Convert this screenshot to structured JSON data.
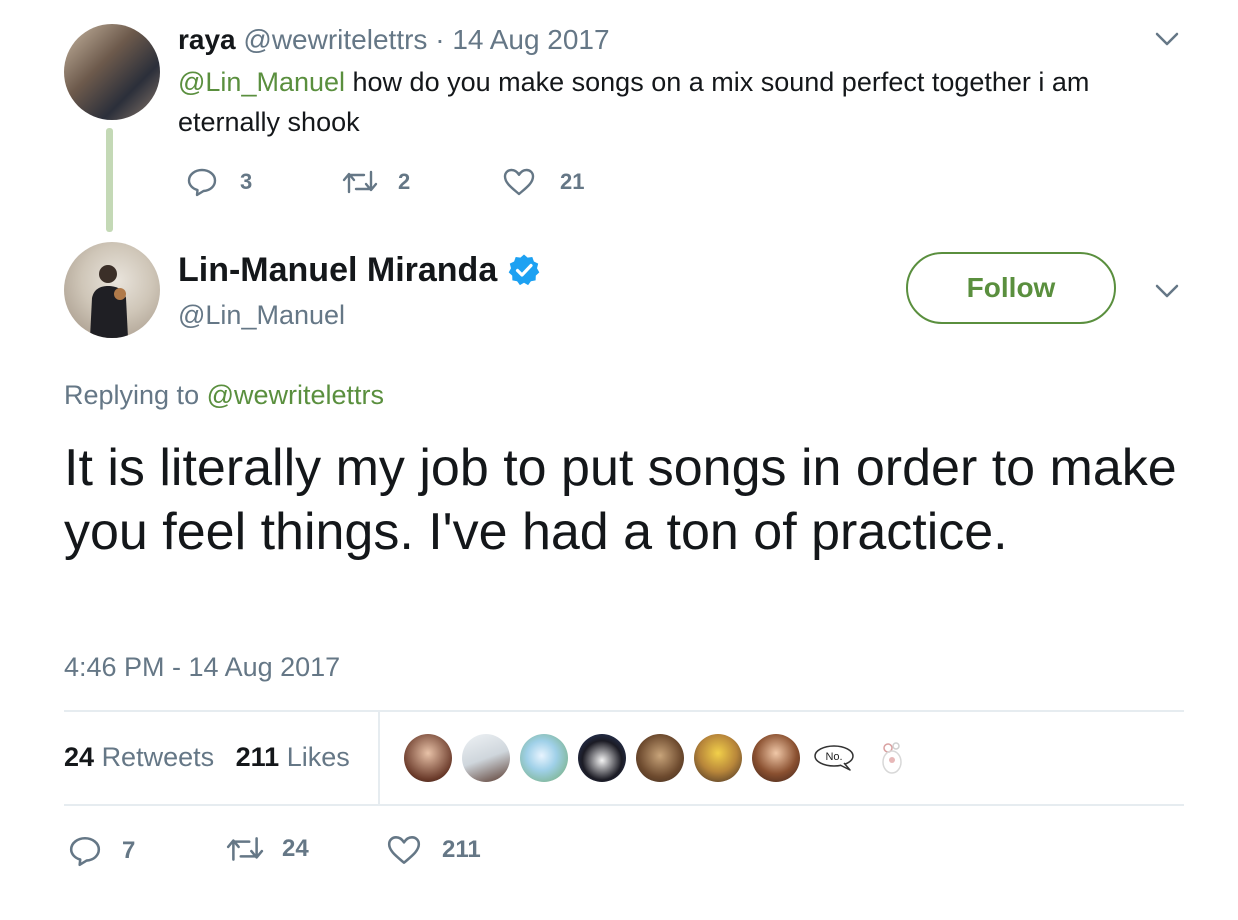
{
  "parent_tweet": {
    "display_name": "raya",
    "handle": "@wewritelettrs",
    "separator": "·",
    "date": "14 Aug 2017",
    "mention": "@Lin_Manuel",
    "text": " how do you make songs on a mix sound perfect together i am eternally shook",
    "reply_count": "3",
    "retweet_count": "2",
    "like_count": "21"
  },
  "main_tweet": {
    "display_name": "Lin-Manuel Miranda",
    "handle": "@Lin_Manuel",
    "verified": true,
    "follow_label": "Follow",
    "replying_prefix": "Replying to ",
    "replying_to": "@wewritelettrs",
    "text": "It is literally my job to put songs in order to make you feel things. I've had a ton of practice.",
    "timestamp": "4:46 PM - 14 Aug 2017",
    "retweets_count": "24",
    "retweets_label": "Retweets",
    "likes_count": "211",
    "likes_label": "Likes",
    "reply_count": "7",
    "retweet_count": "24",
    "like_count": "211",
    "liker_badge_text": "No."
  },
  "colors": {
    "accent": "#5a8f3e",
    "secondary_text": "#657786",
    "verified": "#1da1f2",
    "thread_line": "#c4d9b6"
  },
  "icons": [
    "reply-icon",
    "retweet-icon",
    "like-icon",
    "verified-badge-icon",
    "chevron-down-icon"
  ]
}
